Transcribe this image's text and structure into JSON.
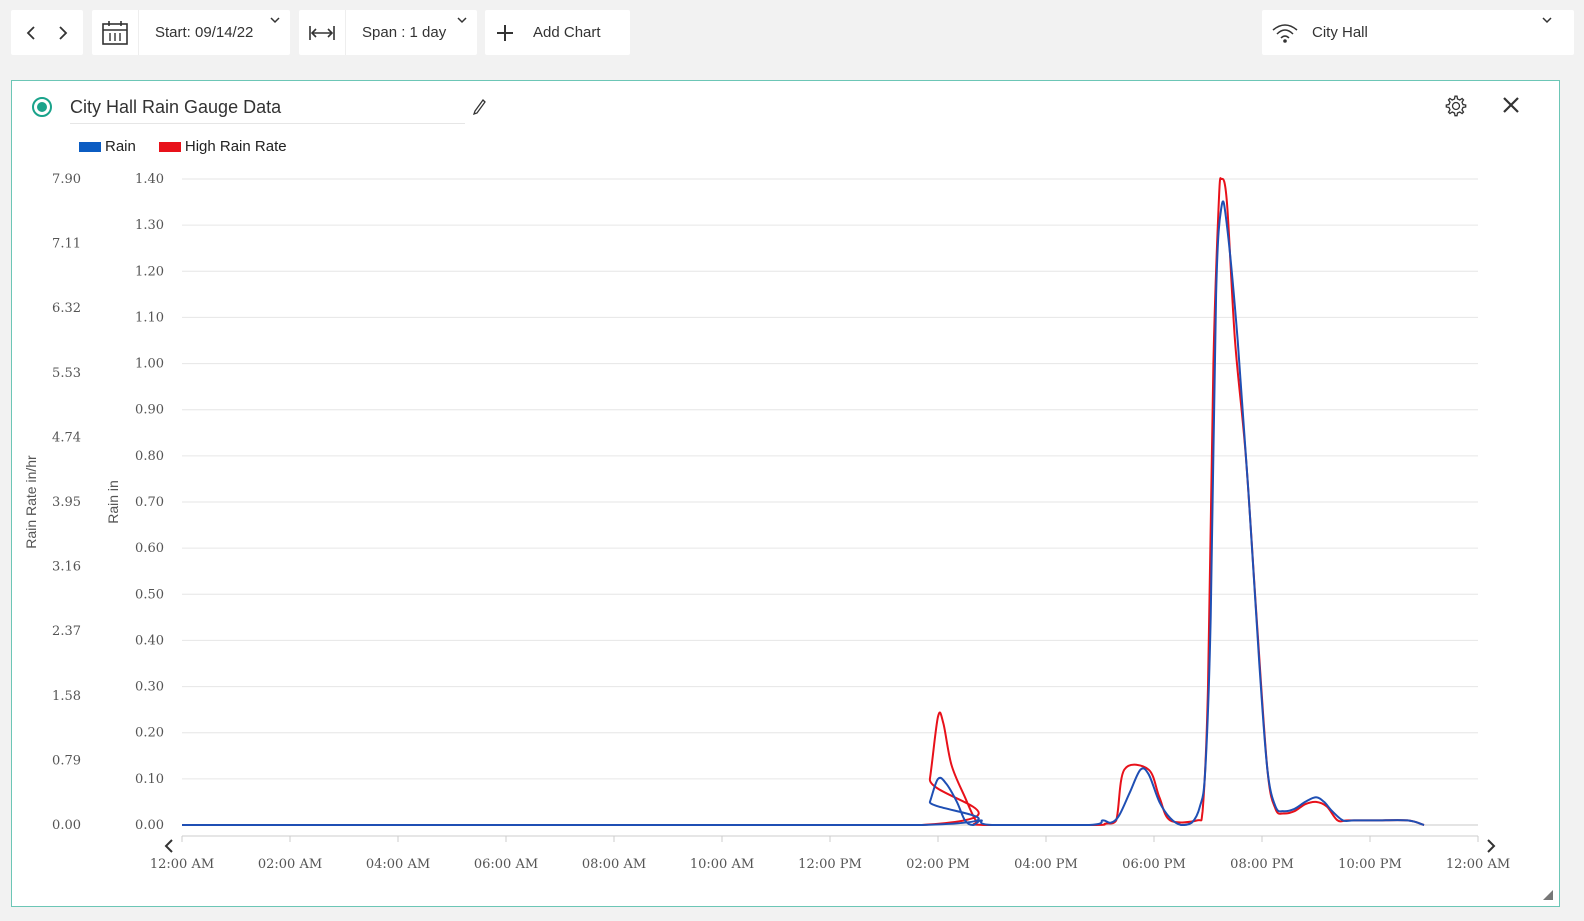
{
  "toolbar": {
    "start_label": "Start: 09/14/22",
    "span_label": "Span : 1 day",
    "add_chart_label": "Add Chart",
    "site_label": "City Hall"
  },
  "panel": {
    "title": "City Hall Rain Gauge Data"
  },
  "colors": {
    "rain": "#1f4fb4",
    "rain_legend": "#0b5cc2",
    "high_rain_rate": "#e8111a",
    "accent": "#1aa38b",
    "border": "#6cc6b6"
  },
  "chart_data": {
    "type": "line",
    "title": "City Hall Rain Gauge Data",
    "legend": {
      "position": "top-left",
      "entries": [
        "Rain",
        "High Rain Rate"
      ]
    },
    "grid": true,
    "xlabel": "",
    "x_ticks": [
      "12:00 AM",
      "02:00 AM",
      "04:00 AM",
      "06:00 AM",
      "08:00 AM",
      "10:00 AM",
      "12:00 PM",
      "02:00 PM",
      "04:00 PM",
      "06:00 PM",
      "08:00 PM",
      "10:00 PM",
      "12:00 AM"
    ],
    "x_range_hours": [
      0,
      24
    ],
    "y_left_outer": {
      "label": "Rain Rate in/hr",
      "ticks": [
        "0.00",
        "0.79",
        "1.58",
        "2.37",
        "3.16",
        "3.95",
        "4.74",
        "5.53",
        "6.32",
        "7.11",
        "7.90"
      ],
      "ylim": [
        0,
        7.9
      ]
    },
    "y_left_inner": {
      "label": "Rain in",
      "ticks": [
        "0.00",
        "0.10",
        "0.20",
        "0.30",
        "0.40",
        "0.50",
        "0.60",
        "0.70",
        "0.80",
        "0.90",
        "1.00",
        "1.10",
        "1.20",
        "1.30",
        "1.40"
      ],
      "ylim": [
        0,
        1.4
      ]
    },
    "series": [
      {
        "name": "Rain",
        "axis": "Rain in",
        "points": [
          [
            0,
            0
          ],
          [
            13.7,
            0
          ],
          [
            13.85,
            0.05
          ],
          [
            14.0,
            0.1
          ],
          [
            14.15,
            0.09
          ],
          [
            14.35,
            0.05
          ],
          [
            14.5,
            0.01
          ],
          [
            14.65,
            0
          ],
          [
            14.8,
            0.01
          ],
          [
            15.0,
            0
          ],
          [
            16.8,
            0
          ],
          [
            17.05,
            0.01
          ],
          [
            17.2,
            0.005
          ],
          [
            17.35,
            0.02
          ],
          [
            17.55,
            0.07
          ],
          [
            17.75,
            0.12
          ],
          [
            17.9,
            0.11
          ],
          [
            18.1,
            0.05
          ],
          [
            18.3,
            0.015
          ],
          [
            18.5,
            0
          ],
          [
            18.7,
            0.005
          ],
          [
            18.85,
            0.04
          ],
          [
            18.95,
            0.12
          ],
          [
            19.05,
            0.45
          ],
          [
            19.15,
            1.15
          ],
          [
            19.25,
            1.34
          ],
          [
            19.35,
            1.3
          ],
          [
            19.55,
            1.05
          ],
          [
            19.75,
            0.72
          ],
          [
            19.95,
            0.35
          ],
          [
            20.1,
            0.12
          ],
          [
            20.25,
            0.04
          ],
          [
            20.4,
            0.03
          ],
          [
            20.6,
            0.035
          ],
          [
            20.8,
            0.05
          ],
          [
            21.0,
            0.06
          ],
          [
            21.15,
            0.05
          ],
          [
            21.3,
            0.03
          ],
          [
            21.5,
            0.01
          ],
          [
            21.7,
            0.01
          ],
          [
            22.1,
            0.01
          ],
          [
            22.7,
            0.01
          ],
          [
            23.0,
            0
          ]
        ]
      },
      {
        "name": "High Rain Rate",
        "axis": "Rain Rate in/hr",
        "points": [
          [
            0,
            0
          ],
          [
            13.7,
            0
          ],
          [
            13.85,
            0.1
          ],
          [
            14.0,
            0.235
          ],
          [
            14.1,
            0.22
          ],
          [
            14.25,
            0.13
          ],
          [
            14.5,
            0.06
          ],
          [
            14.7,
            0.01
          ],
          [
            14.85,
            0
          ],
          [
            16.85,
            0
          ],
          [
            17.1,
            0.003
          ],
          [
            17.3,
            0.01
          ],
          [
            17.45,
            0.12
          ],
          [
            17.9,
            0.12
          ],
          [
            18.1,
            0.06
          ],
          [
            18.3,
            0.01
          ],
          [
            18.8,
            0.01
          ],
          [
            18.9,
            0.03
          ],
          [
            19.0,
            0.3
          ],
          [
            19.1,
            1.0
          ],
          [
            19.2,
            1.35
          ],
          [
            19.25,
            1.4
          ],
          [
            19.35,
            1.35
          ],
          [
            19.5,
            1.05
          ],
          [
            19.7,
            0.8
          ],
          [
            19.9,
            0.45
          ],
          [
            20.1,
            0.12
          ],
          [
            20.25,
            0.035
          ],
          [
            20.4,
            0.025
          ],
          [
            20.6,
            0.03
          ],
          [
            20.8,
            0.045
          ],
          [
            21.0,
            0.05
          ],
          [
            21.2,
            0.04
          ],
          [
            21.4,
            0.01
          ],
          [
            21.6,
            0.01
          ],
          [
            22.1,
            0.01
          ],
          [
            22.7,
            0.01
          ],
          [
            23.0,
            0
          ]
        ]
      }
    ]
  }
}
